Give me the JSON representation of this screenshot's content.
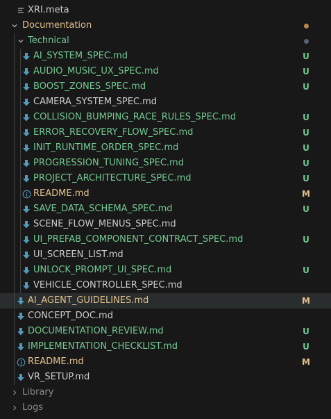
{
  "colors": {
    "background": "#181818",
    "untracked": "#73c991",
    "modified": "#e2c08d",
    "folder_modified": "#e2c08d",
    "dim": "#8c8c8c",
    "selected_row": "#2a2d2e",
    "icon_blue": "#519aba",
    "dot_orange": "#b8854a",
    "dot_gray": "#5a6472"
  },
  "tree": {
    "xri_meta": {
      "label": "XRI.meta",
      "icon": "lines-icon"
    },
    "documentation": {
      "label": "Documentation",
      "icon": "chevron-down-icon"
    },
    "technical": {
      "label": "Technical",
      "icon": "chevron-down-icon"
    },
    "technical_files": [
      {
        "label": "AI_SYSTEM_SPEC.md",
        "status": "U",
        "icon": "download-arrow-icon"
      },
      {
        "label": "AUDIO_MUSIC_UX_SPEC.md",
        "status": "U",
        "icon": "download-arrow-icon"
      },
      {
        "label": "BOOST_ZONES_SPEC.md",
        "status": "U",
        "icon": "download-arrow-icon"
      },
      {
        "label": "CAMERA_SYSTEM_SPEC.md",
        "status": "",
        "icon": "download-arrow-icon"
      },
      {
        "label": "COLLISION_BUMPING_RACE_RULES_SPEC.md",
        "status": "U",
        "icon": "download-arrow-icon"
      },
      {
        "label": "ERROR_RECOVERY_FLOW_SPEC.md",
        "status": "U",
        "icon": "download-arrow-icon"
      },
      {
        "label": "INIT_RUNTIME_ORDER_SPEC.md",
        "status": "U",
        "icon": "download-arrow-icon"
      },
      {
        "label": "PROGRESSION_TUNING_SPEC.md",
        "status": "U",
        "icon": "download-arrow-icon"
      },
      {
        "label": "PROJECT_ARCHITECTURE_SPEC.md",
        "status": "U",
        "icon": "download-arrow-icon"
      },
      {
        "label": "README.md",
        "status": "M",
        "icon": "info-icon"
      },
      {
        "label": "SAVE_DATA_SCHEMA_SPEC.md",
        "status": "U",
        "icon": "download-arrow-icon"
      },
      {
        "label": "SCENE_FLOW_MENUS_SPEC.md",
        "status": "",
        "icon": "download-arrow-icon"
      },
      {
        "label": "UI_PREFAB_COMPONENT_CONTRACT_SPEC.md",
        "status": "U",
        "icon": "download-arrow-icon"
      },
      {
        "label": "UI_SCREEN_LIST.md",
        "status": "",
        "icon": "download-arrow-icon"
      },
      {
        "label": "UNLOCK_PROMPT_UI_SPEC.md",
        "status": "U",
        "icon": "download-arrow-icon"
      },
      {
        "label": "VEHICLE_CONTROLLER_SPEC.md",
        "status": "",
        "icon": "download-arrow-icon"
      }
    ],
    "documentation_files": [
      {
        "label": "AI_AGENT_GUIDELINES.md",
        "status": "M",
        "icon": "download-arrow-icon",
        "selected": true
      },
      {
        "label": "CONCEPT_DOC.md",
        "status": "",
        "icon": "download-arrow-icon"
      },
      {
        "label": "DOCUMENTATION_REVIEW.md",
        "status": "U",
        "icon": "download-arrow-icon"
      },
      {
        "label": "IMPLEMENTATION_CHECKLIST.md",
        "status": "U",
        "icon": "download-arrow-icon"
      },
      {
        "label": "README.md",
        "status": "M",
        "icon": "info-icon"
      },
      {
        "label": "VR_SETUP.md",
        "status": "",
        "icon": "download-arrow-icon"
      }
    ],
    "library": {
      "label": "Library",
      "icon": "chevron-right-icon"
    },
    "logs": {
      "label": "Logs",
      "icon": "chevron-right-icon"
    }
  }
}
